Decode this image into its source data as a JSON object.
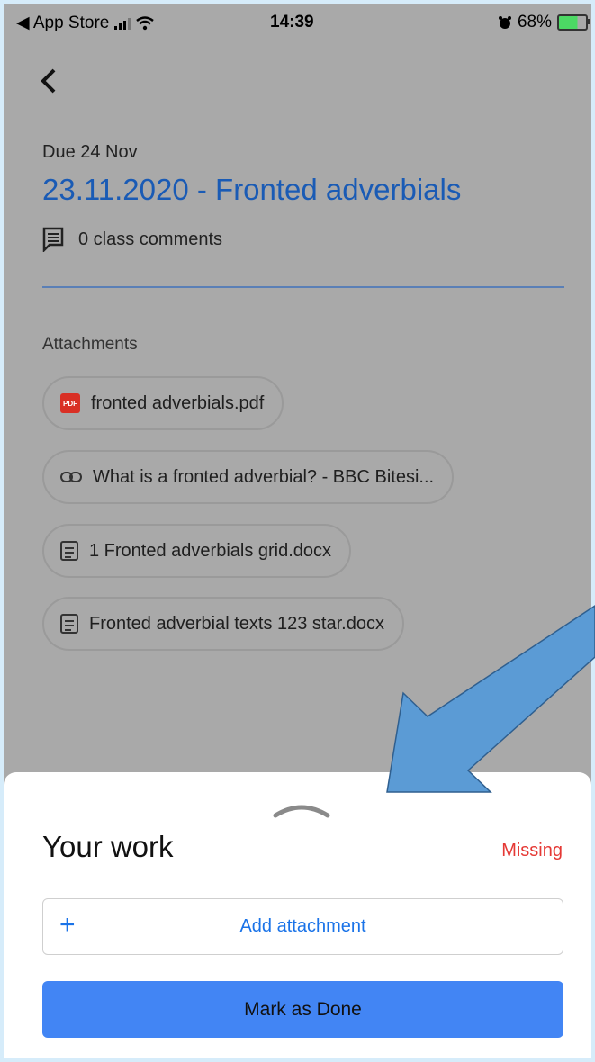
{
  "status_bar": {
    "back_app": "◀ App Store",
    "time": "14:39",
    "battery": "68%"
  },
  "assignment": {
    "due": "Due 24 Nov",
    "title": "23.11.2020 - Fronted adverbials",
    "comments": "0 class comments"
  },
  "attachments": {
    "label": "Attachments",
    "items": [
      {
        "icon": "pdf-icon",
        "name": "fronted adverbials.pdf"
      },
      {
        "icon": "link-icon",
        "name": "What is a fronted adverbial? - BBC Bitesi..."
      },
      {
        "icon": "doc-icon",
        "name": "1 Fronted adverbials grid.docx"
      },
      {
        "icon": "doc-icon",
        "name": "Fronted adverbial texts 123 star.docx"
      }
    ]
  },
  "your_work": {
    "heading": "Your work",
    "status": "Missing",
    "add_attachment": "Add attachment",
    "mark_done": "Mark as Done"
  },
  "colors": {
    "accent": "#1a73e8",
    "title": "#1a5bb5",
    "missing": "#e53935",
    "done_button": "#4285f4",
    "arrow": "#5b9bd5"
  }
}
